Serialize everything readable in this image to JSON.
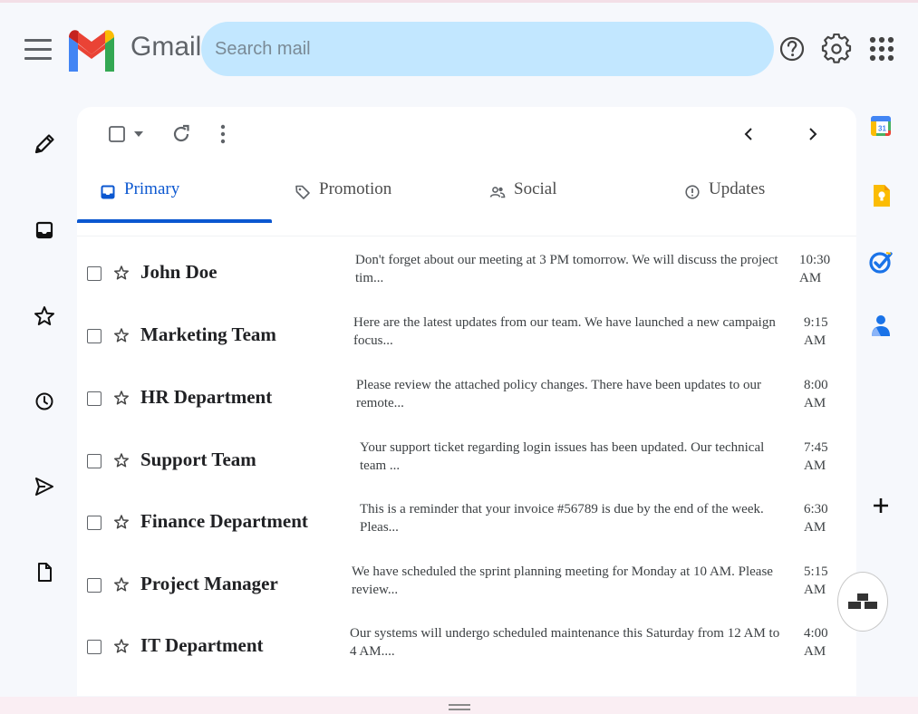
{
  "header": {
    "app_name": "Gmail",
    "search_placeholder": "Search mail",
    "icons": [
      "menu-icon",
      "help-icon",
      "gear-icon",
      "apps-grid-icon"
    ]
  },
  "left_rail": {
    "icons": [
      "compose-pencil-icon",
      "inbox-icon",
      "star-icon",
      "clock-icon",
      "send-icon",
      "draft-icon"
    ]
  },
  "toolbar": {
    "icons": [
      "select-checkbox-icon",
      "dropdown-caret-icon",
      "refresh-icon",
      "more-vert-icon",
      "chevron-left-icon",
      "chevron-right-icon"
    ]
  },
  "tabs": [
    {
      "label": "Primary",
      "icon": "inbox-icon",
      "active": true
    },
    {
      "label": "Promotion",
      "icon": "tag-icon",
      "active": false
    },
    {
      "label": "Social",
      "icon": "people-icon",
      "active": false
    },
    {
      "label": "Updates",
      "icon": "info-icon",
      "active": false
    }
  ],
  "emails": [
    {
      "sender": "John Doe",
      "snippet": "Don't forget about our meeting at 3 PM tomorrow. We will discuss the project tim...",
      "time": "10:30 AM"
    },
    {
      "sender": "Marketing Team",
      "snippet": "Here are the latest updates from our team. We have launched a new campaign focus...",
      "time": "9:15 AM"
    },
    {
      "sender": "HR Department",
      "snippet": "Please review the attached policy changes. There have been updates to our remote...",
      "time": "8:00 AM"
    },
    {
      "sender": "Support Team",
      "snippet": "Your support ticket regarding login issues has been updated. Our technical team ...",
      "time": "7:45 AM"
    },
    {
      "sender": "Finance Department",
      "snippet": "This is a reminder that your invoice #56789 is due by the end of the week. Pleas...",
      "time": "6:30 AM"
    },
    {
      "sender": "Project Manager",
      "snippet": "We have scheduled the sprint planning meeting for Monday at 10 AM. Please review...",
      "time": "5:15 AM"
    },
    {
      "sender": "IT Department",
      "snippet": "Our systems will undergo scheduled maintenance this Saturday from 12 AM to 4 AM....",
      "time": "4:00 AM"
    }
  ],
  "side_panel": {
    "calendar_day": "31",
    "icons": [
      "calendar-icon",
      "keep-icon",
      "tasks-icon",
      "contacts-icon",
      "add-icon"
    ]
  },
  "colors": {
    "accent": "#0b57d0",
    "search_bg": "#c2e7ff",
    "page_bg": "#f6f8fc"
  }
}
